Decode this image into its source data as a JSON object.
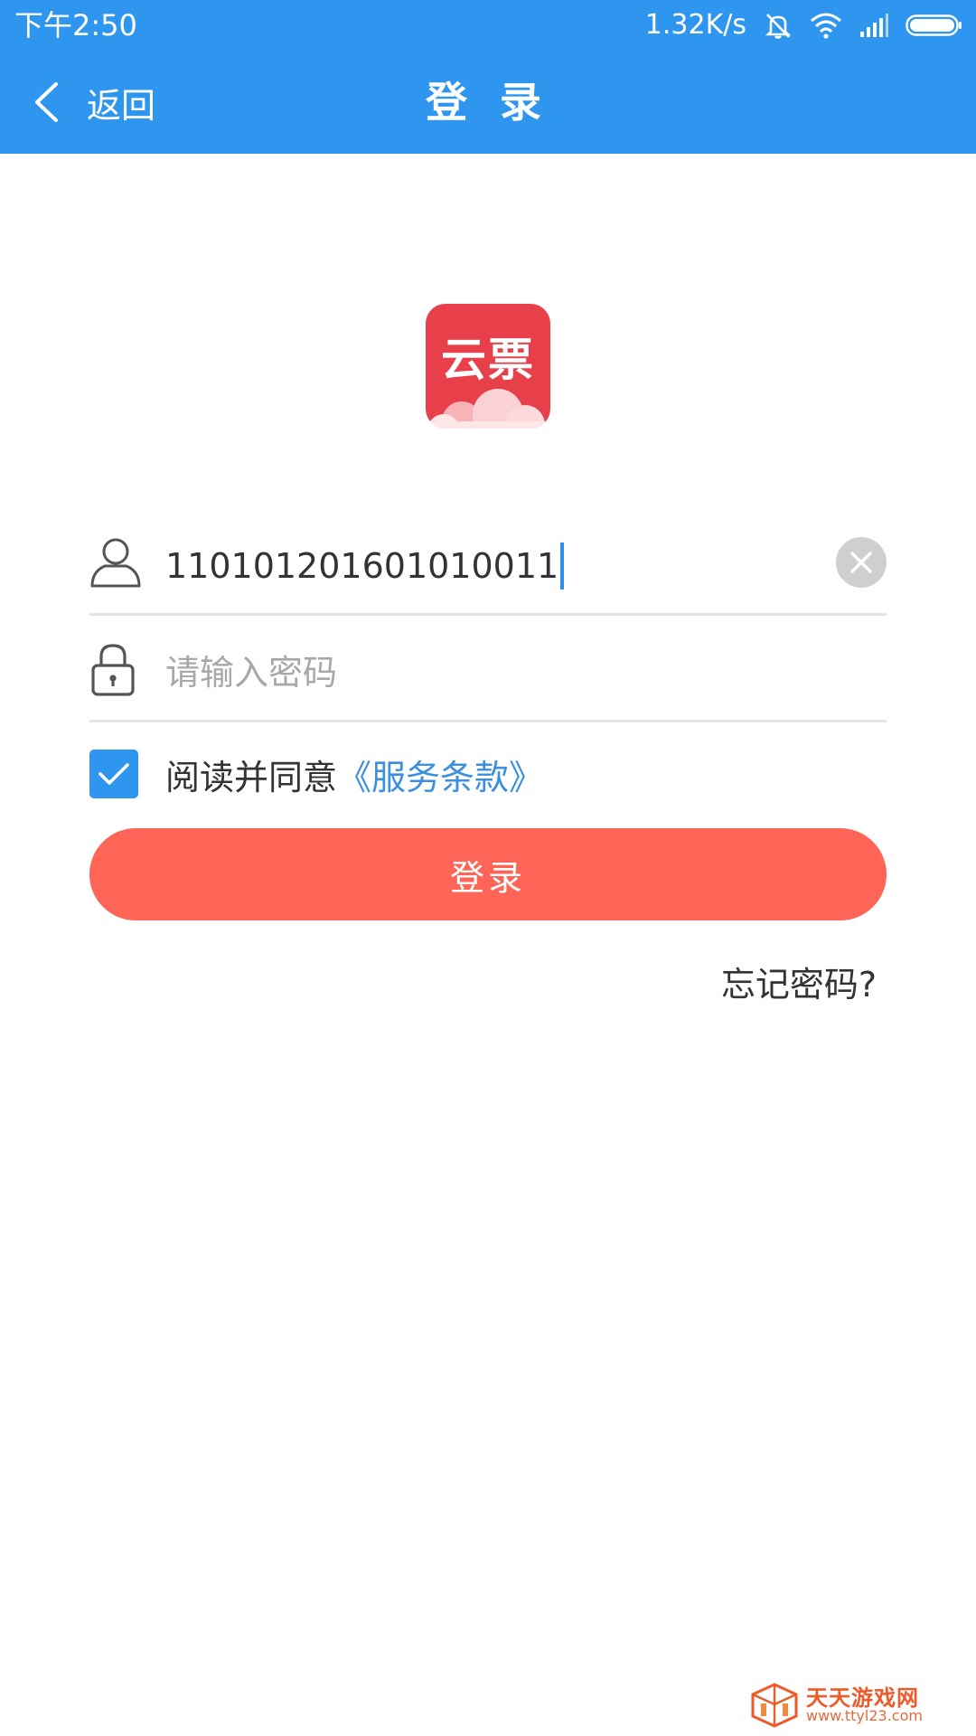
{
  "status_bar": {
    "time": "下午2:50",
    "network_speed": "1.32K/s",
    "icons": [
      "mute-icon",
      "wifi-icon",
      "signal-icon",
      "battery-icon"
    ]
  },
  "nav": {
    "back_label": "返回",
    "title": "登 录"
  },
  "logo": {
    "text": "云票",
    "color": "#e8404a"
  },
  "form": {
    "username_value": "110101201601010011",
    "password_placeholder": "请输入密码",
    "agree_text": "阅读并同意",
    "terms_link": "《服务条款》",
    "agree_checked": true,
    "login_label": "登录",
    "forgot_label": "忘记密码?"
  },
  "watermark": {
    "name": "天天游戏网",
    "url": "www.ttyl23.com"
  },
  "colors": {
    "header": "#2f96ef",
    "login_button": "#fe6557",
    "link": "#3a8fe0",
    "checkbox": "#2f96ef"
  }
}
